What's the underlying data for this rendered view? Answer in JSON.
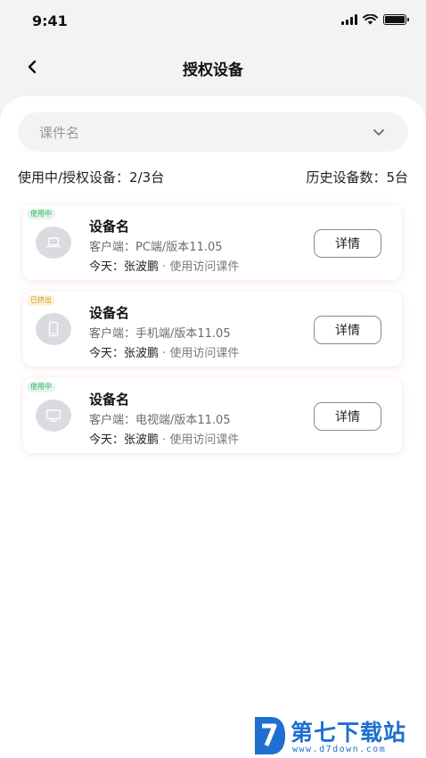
{
  "status_bar": {
    "time": "9:41"
  },
  "nav": {
    "title": "授权设备"
  },
  "filter": {
    "placeholder": "课件名"
  },
  "summary": {
    "active_label": "使用中/授权设备：2/3台",
    "history_label": "历史设备数：5台"
  },
  "devices": [
    {
      "badge": "使用中",
      "badge_color": "#3fae6a",
      "icon": "laptop-icon",
      "name": "设备名",
      "client": "客户端：PC端/版本11.05",
      "usage_today": "今天：张波鹏",
      "usage_action": "· 使用访问课件",
      "button": "详情"
    },
    {
      "badge": "已挤出",
      "badge_color": "#d29b2b",
      "icon": "phone-icon",
      "name": "设备名",
      "client": "客户端：手机端/版本11.05",
      "usage_today": "今天：张波鹏",
      "usage_action": "· 使用访问课件",
      "button": "详情"
    },
    {
      "badge": "使用中",
      "badge_color": "#3fae6a",
      "icon": "tv-icon",
      "name": "设备名",
      "client": "客户端：电视端/版本11.05",
      "usage_today": "今天：张波鹏",
      "usage_action": "· 使用访问课件",
      "button": "详情"
    }
  ],
  "watermark": {
    "title": "第七下载站",
    "url": "www.d7down.com"
  }
}
